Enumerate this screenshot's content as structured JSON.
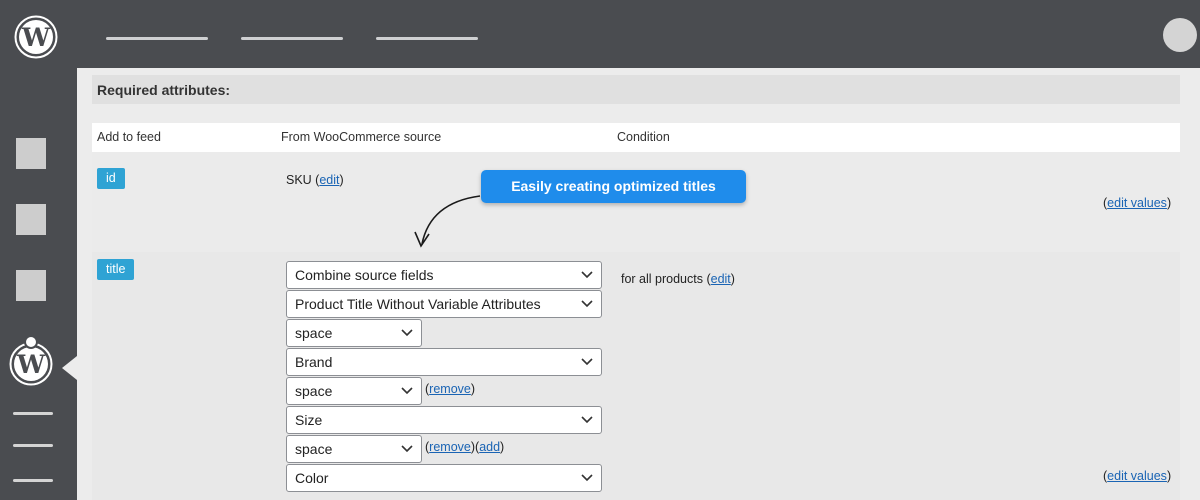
{
  "section": {
    "title": "Required attributes:"
  },
  "columns": {
    "add_to_feed": "Add to feed",
    "source": "From WooCommerce source",
    "condition": "Condition"
  },
  "rows": {
    "id": {
      "tag": "id",
      "source_text": "SKU (",
      "edit_label": "edit",
      "source_close": ")",
      "edit_values_open": "(",
      "edit_values_label": "edit values",
      "edit_values_close": ")"
    },
    "title": {
      "tag": "title",
      "selects": [
        "Combine source fields",
        "Product Title Without Variable Attributes",
        "space",
        "Brand",
        "space",
        "Size",
        "space",
        "Color"
      ],
      "remove_label": "remove",
      "add_label": "add",
      "condition_text": "for all products (",
      "condition_edit": "edit",
      "condition_close": ")",
      "edit_values_open": "(",
      "edit_values_label": "edit values",
      "edit_values_close": ")"
    }
  },
  "callout": {
    "text": "Easily creating optimized titles"
  },
  "icons": {
    "top_logo": "wordpress-logo-icon",
    "sidebar_logo": "wordpress-logo-icon",
    "select_arrow": "chevron-down-icon"
  },
  "colors": {
    "accent": "#2fa3d4",
    "callout": "#1f8ceb",
    "link": "#1a64b4",
    "chrome": "#4a4c50"
  }
}
